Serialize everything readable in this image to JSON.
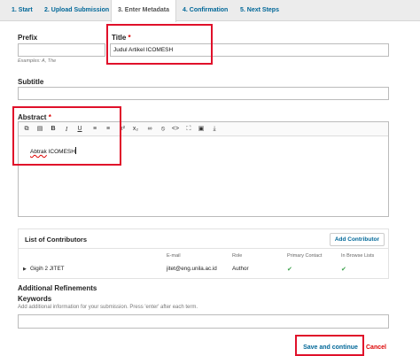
{
  "tabs": [
    {
      "label": "1. Start"
    },
    {
      "label": "2. Upload Submission"
    },
    {
      "label": "3. Enter Metadata"
    },
    {
      "label": "4. Confirmation"
    },
    {
      "label": "5. Next Steps"
    }
  ],
  "prefix": {
    "label": "Prefix",
    "value": "",
    "hint": "Examples: A, The"
  },
  "title": {
    "label": "Title",
    "required_mark": "*",
    "value": "Judul Artikel ICOMESH"
  },
  "subtitle": {
    "label": "Subtitle",
    "value": ""
  },
  "abstract": {
    "label": "Abstract",
    "required_mark": "*",
    "text_misspelled": "Abtrak",
    "text_rest": " ICOMESH",
    "toolbar_icons": [
      "copy-icon",
      "paste-icon",
      "bold-icon",
      "italic-icon",
      "underline-icon",
      "bullet-list-icon",
      "numbered-list-icon",
      "superscript-icon",
      "subscript-icon",
      "link-icon",
      "unlink-icon",
      "code-icon",
      "fullscreen-icon",
      "image-icon",
      "upload-icon"
    ]
  },
  "contributors": {
    "title": "List of Contributors",
    "add_button": "Add Contributor",
    "columns": {
      "name": "",
      "email": "E-mail",
      "role": "Role",
      "primary": "Primary Contact",
      "browse": "In Browse Lists"
    },
    "rows": [
      {
        "name": "Gigih 2 JITET",
        "email": "jitet@eng.unila.ac.id",
        "role": "Author",
        "primary": true,
        "browse": true
      }
    ]
  },
  "refinements": {
    "label": "Additional Refinements"
  },
  "keywords": {
    "label": "Keywords",
    "hint": "Add additional information for your submission. Press 'enter' after each term.",
    "value": ""
  },
  "actions": {
    "save": "Save and continue",
    "cancel": "Cancel"
  },
  "colors": {
    "link": "#006798",
    "highlight": "#e0102a",
    "check": "#3aa14a"
  }
}
